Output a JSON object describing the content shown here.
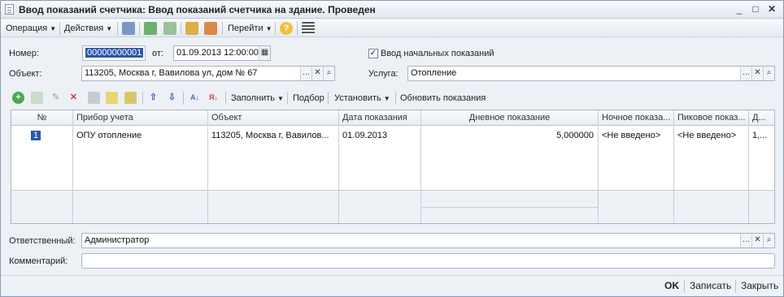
{
  "window": {
    "title": "Ввод показаний счетчика: Ввод показаний счетчика на здание. Проведен"
  },
  "toolbar": {
    "operation_label": "Операция",
    "actions_label": "Действия",
    "goto_label": "Перейти"
  },
  "form": {
    "number_label": "Номер:",
    "number_value": "00000000001",
    "from_label": "от:",
    "date_value": "01.09.2013 12:00:00",
    "initial_readings_label": "Ввод начальных показаний",
    "initial_readings_checked": true,
    "object_label": "Объект:",
    "object_value": "113205, Москва г, Вавилова ул, дом № 67",
    "service_label": "Услуга:",
    "service_value": "Отопление",
    "responsible_label": "Ответственный:",
    "responsible_value": "Администратор",
    "comment_label": "Комментарий:",
    "comment_value": ""
  },
  "table_toolbar": {
    "fill_label": "Заполнить",
    "pick_label": "Подбор",
    "set_label": "Установить",
    "refresh_label": "Обновить показания"
  },
  "table": {
    "columns": [
      "№",
      "Прибор учета",
      "Объект",
      "Дата показания",
      "Дневное показание",
      "Ночное показа...",
      "Пиковое показ...",
      "Д..."
    ],
    "rows": [
      [
        "1",
        "ОПУ отопление",
        "113205, Москва г, Вавилов...",
        "01.09.2013",
        "5,000000",
        "<Не введено>",
        "<Не введено>",
        "1,..."
      ]
    ]
  },
  "bottom": {
    "ok_label": "OK",
    "save_label": "Записать",
    "close_label": "Закрыть"
  }
}
